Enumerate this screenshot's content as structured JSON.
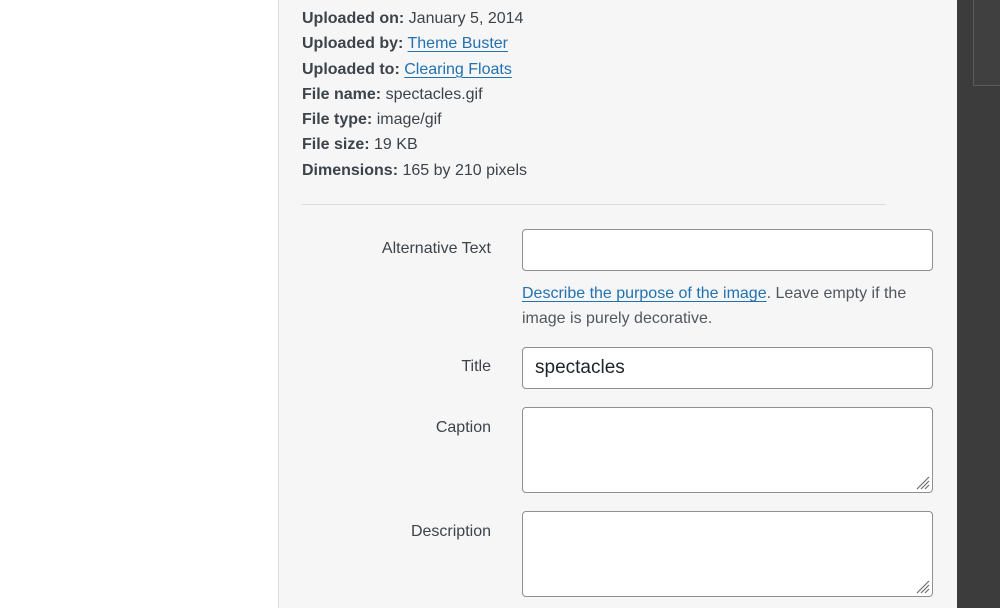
{
  "meta": {
    "uploaded_on": {
      "label": "Uploaded on:",
      "value": "January 5, 2014"
    },
    "uploaded_by": {
      "label": "Uploaded by:",
      "value": "Theme Buster"
    },
    "uploaded_to": {
      "label": "Uploaded to:",
      "value": "Clearing Floats"
    },
    "file_name": {
      "label": "File name:",
      "value": "spectacles.gif"
    },
    "file_type": {
      "label": "File type:",
      "value": "image/gif"
    },
    "file_size": {
      "label": "File size:",
      "value": "19 KB"
    },
    "dimensions": {
      "label": "Dimensions:",
      "value": "165 by 210 pixels"
    }
  },
  "form": {
    "alt_text": {
      "label": "Alternative Text",
      "value": ""
    },
    "help": {
      "link": "Describe the purpose of the image",
      "rest": ". Leave empty if the image is purely decorative."
    },
    "title": {
      "label": "Title",
      "value": "spectacles"
    },
    "caption": {
      "label": "Caption",
      "value": ""
    },
    "description": {
      "label": "Description",
      "value": ""
    }
  }
}
